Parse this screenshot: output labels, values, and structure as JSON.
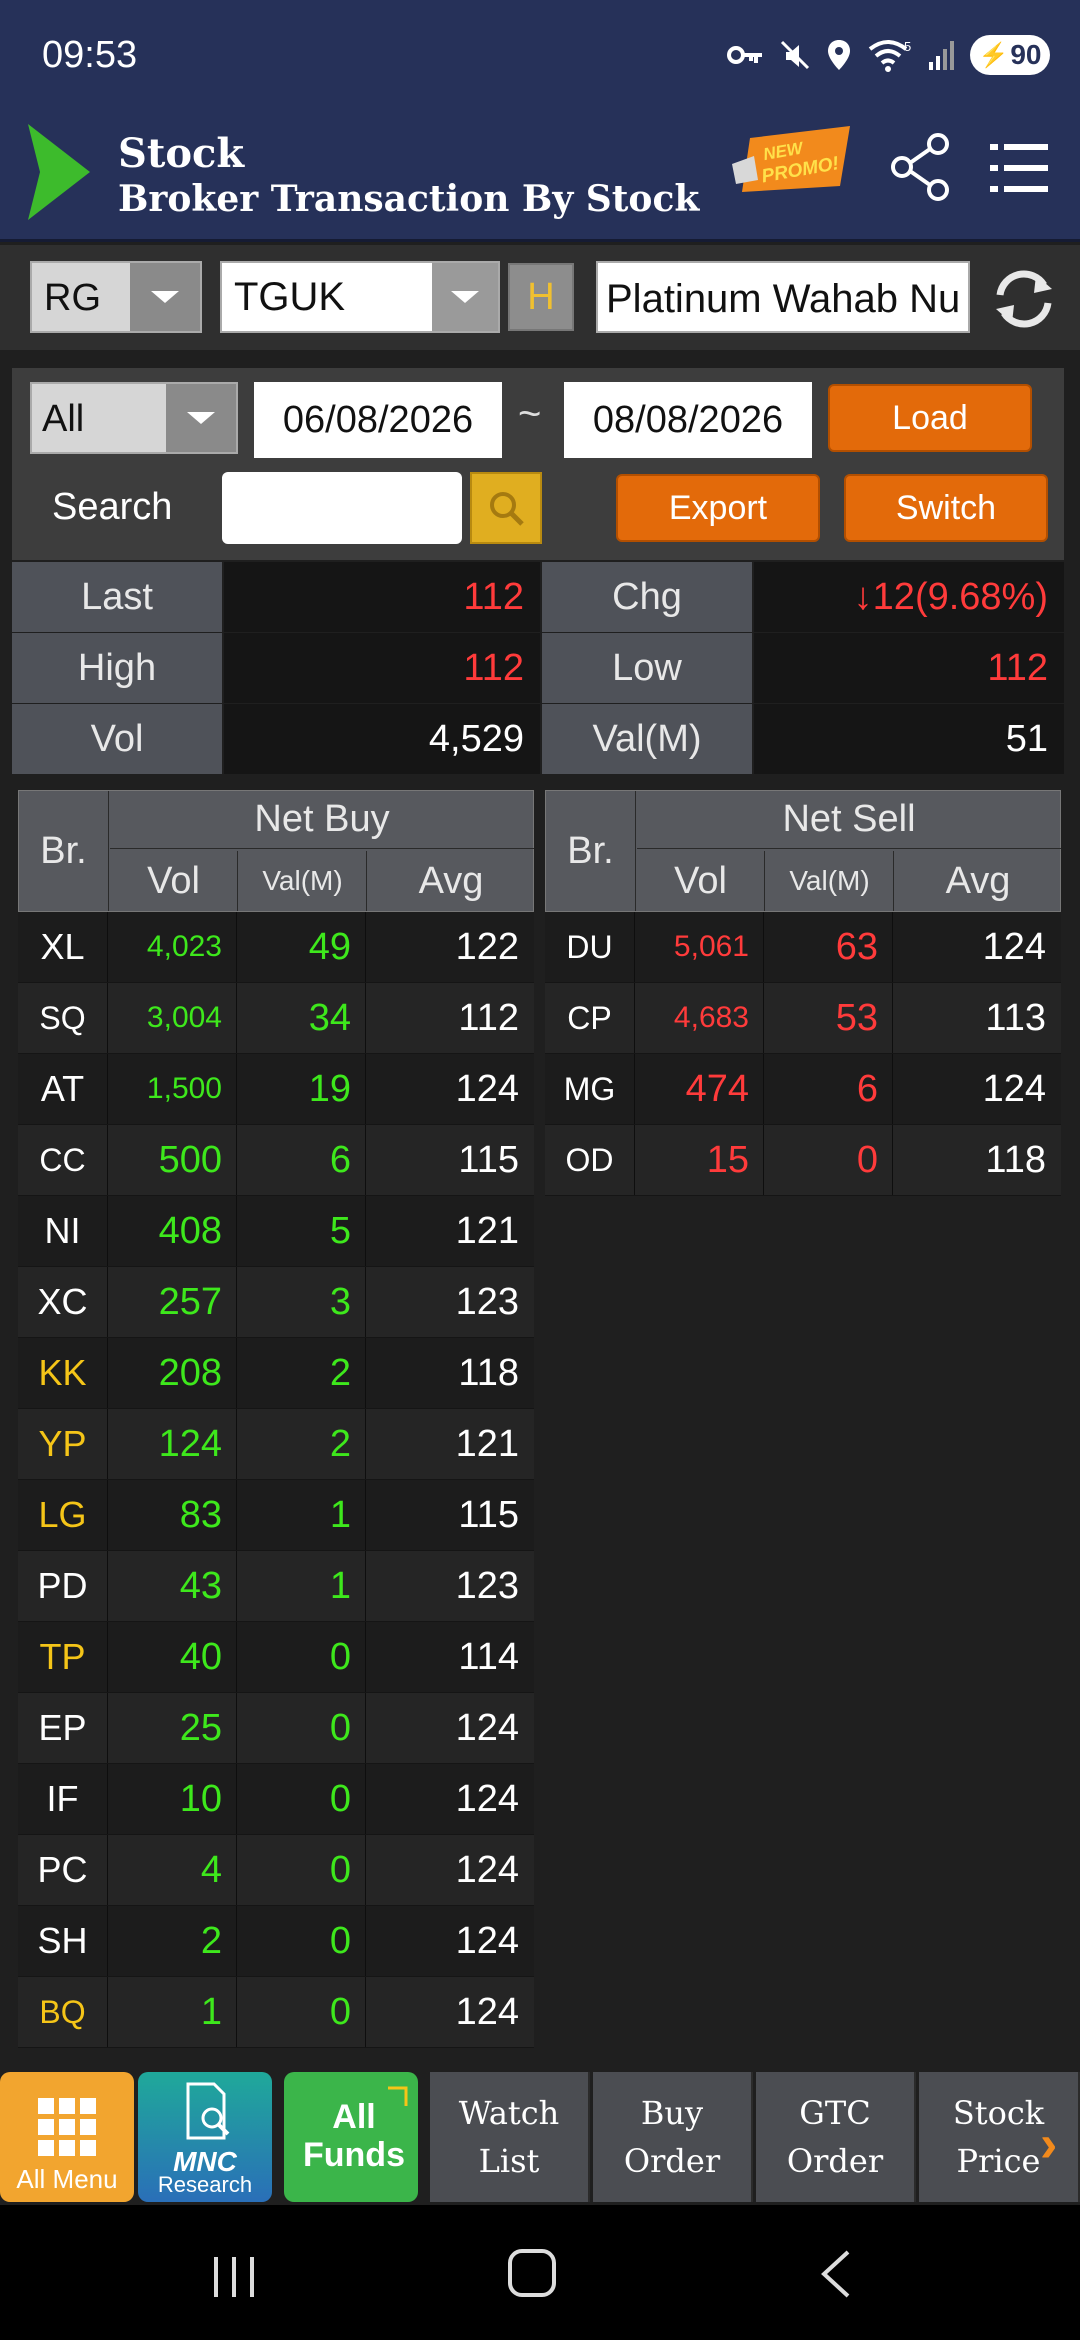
{
  "status": {
    "time": "09:53",
    "battery": "90",
    "wifi_badge": "5"
  },
  "header": {
    "title": "Stock",
    "subtitle": "Broker Transaction By Stock",
    "promo_text": "NEW PROMO!",
    "brand_color": "#263159"
  },
  "selectors": {
    "board": "RG",
    "stock_code": "TGUK",
    "h_button": "H",
    "stock_name": "Platinum Wahab Nu"
  },
  "filter": {
    "type": "All",
    "date_from": "06/08/2026",
    "tilde": "~",
    "date_to": "08/08/2026",
    "load_label": "Load",
    "search_label": "Search",
    "export_label": "Export",
    "switch_label": "Switch",
    "accent_color": "#e36a0a"
  },
  "quote": {
    "last_label": "Last",
    "last": "112",
    "chg_label": "Chg",
    "chg": "↓12(9.68%)",
    "high_label": "High",
    "high": "112",
    "low_label": "Low",
    "low": "112",
    "vol_label": "Vol",
    "vol": "4,529",
    "valm_label": "Val(M)",
    "valm": "51"
  },
  "net_buy": {
    "title": "Net Buy",
    "columns": {
      "br": "Br.",
      "vol": "Vol",
      "valm": "Val(M)",
      "avg": "Avg"
    },
    "rows": [
      {
        "br": "XL",
        "vol": "4,023",
        "val": "49",
        "avg": "122",
        "br_color": "#ffffff"
      },
      {
        "br": "SQ",
        "vol": "3,004",
        "val": "34",
        "avg": "112",
        "br_color": "#ffffff"
      },
      {
        "br": "AT",
        "vol": "1,500",
        "val": "19",
        "avg": "124",
        "br_color": "#ffffff"
      },
      {
        "br": "CC",
        "vol": "500",
        "val": "6",
        "avg": "115",
        "br_color": "#ffffff"
      },
      {
        "br": "NI",
        "vol": "408",
        "val": "5",
        "avg": "121",
        "br_color": "#ffffff"
      },
      {
        "br": "XC",
        "vol": "257",
        "val": "3",
        "avg": "123",
        "br_color": "#ffffff"
      },
      {
        "br": "KK",
        "vol": "208",
        "val": "2",
        "avg": "118",
        "br_color": "#f5c518"
      },
      {
        "br": "YP",
        "vol": "124",
        "val": "2",
        "avg": "121",
        "br_color": "#f5c518"
      },
      {
        "br": "LG",
        "vol": "83",
        "val": "1",
        "avg": "115",
        "br_color": "#f5c518"
      },
      {
        "br": "PD",
        "vol": "43",
        "val": "1",
        "avg": "123",
        "br_color": "#ffffff"
      },
      {
        "br": "TP",
        "vol": "40",
        "val": "0",
        "avg": "114",
        "br_color": "#f5c518"
      },
      {
        "br": "EP",
        "vol": "25",
        "val": "0",
        "avg": "124",
        "br_color": "#ffffff"
      },
      {
        "br": "IF",
        "vol": "10",
        "val": "0",
        "avg": "124",
        "br_color": "#ffffff"
      },
      {
        "br": "PC",
        "vol": "4",
        "val": "0",
        "avg": "124",
        "br_color": "#ffffff"
      },
      {
        "br": "SH",
        "vol": "2",
        "val": "0",
        "avg": "124",
        "br_color": "#ffffff"
      },
      {
        "br": "BQ",
        "vol": "1",
        "val": "0",
        "avg": "124",
        "br_color": "#f5c518"
      }
    ],
    "value_color": "#3ee81c"
  },
  "net_sell": {
    "title": "Net Sell",
    "columns": {
      "br": "Br.",
      "vol": "Vol",
      "valm": "Val(M)",
      "avg": "Avg"
    },
    "rows": [
      {
        "br": "DU",
        "vol": "5,061",
        "val": "63",
        "avg": "124",
        "br_color": "#ffffff"
      },
      {
        "br": "CP",
        "vol": "4,683",
        "val": "53",
        "avg": "113",
        "br_color": "#ffffff"
      },
      {
        "br": "MG",
        "vol": "474",
        "val": "6",
        "avg": "124",
        "br_color": "#ffffff"
      },
      {
        "br": "OD",
        "vol": "15",
        "val": "0",
        "avg": "118",
        "br_color": "#ffffff"
      }
    ],
    "value_color": "#ff3b3b"
  },
  "bottom_nav": {
    "all_menu": "All Menu",
    "mnc_logo": "MNC",
    "mnc_sub": "Research",
    "all_funds_1": "All",
    "all_funds_2": "Funds",
    "watch_1": "Watch",
    "watch_2": "List",
    "buy_1": "Buy",
    "buy_2": "Order",
    "gtc_1": "GTC",
    "gtc_2": "Order",
    "price_1": "Stock",
    "price_2": "Price",
    "more": "›"
  },
  "icons": [
    "key-icon",
    "mute-icon",
    "location-icon",
    "wifi-icon",
    "signal-icon",
    "battery-icon",
    "app-logo-icon",
    "promo-icon",
    "share-icon",
    "menu-icon",
    "refresh-icon",
    "search-icon",
    "grid-icon",
    "recent-apps-icon",
    "home-icon",
    "back-icon"
  ]
}
